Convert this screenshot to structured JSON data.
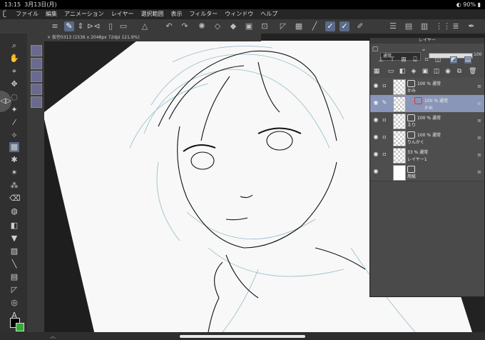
{
  "status": {
    "time": "13:15",
    "date": "3月13日(月)",
    "battery": "90%"
  },
  "menu": {
    "items": [
      "ファイル",
      "編集",
      "アニメーション",
      "レイヤー",
      "選択範囲",
      "表示",
      "フィルター",
      "ウィンドウ",
      "ヘルプ"
    ]
  },
  "document": {
    "tab": "× 仮壱0313 (1536 x 2048px 72dpi 121.9%)"
  },
  "layers": {
    "title": "レイヤー",
    "blend_mode": "通常",
    "opacity": "100",
    "items": [
      {
        "line1": "100 % 通常",
        "name": "かみ",
        "selected": false
      },
      {
        "line1": "100 % 通常",
        "name": "かお",
        "selected": true
      },
      {
        "line1": "100 % 通常",
        "name": "えり",
        "selected": false
      },
      {
        "line1": "100 % 通常",
        "name": "りんかく",
        "selected": false
      },
      {
        "line1": "33 % 通常",
        "name": "レイヤー1",
        "selected": false
      },
      {
        "line1": "",
        "name": "用紙",
        "selected": false
      }
    ]
  },
  "colors": {
    "main": "#000000",
    "sub": "#33aa33",
    "selection": "#8a96b8"
  }
}
